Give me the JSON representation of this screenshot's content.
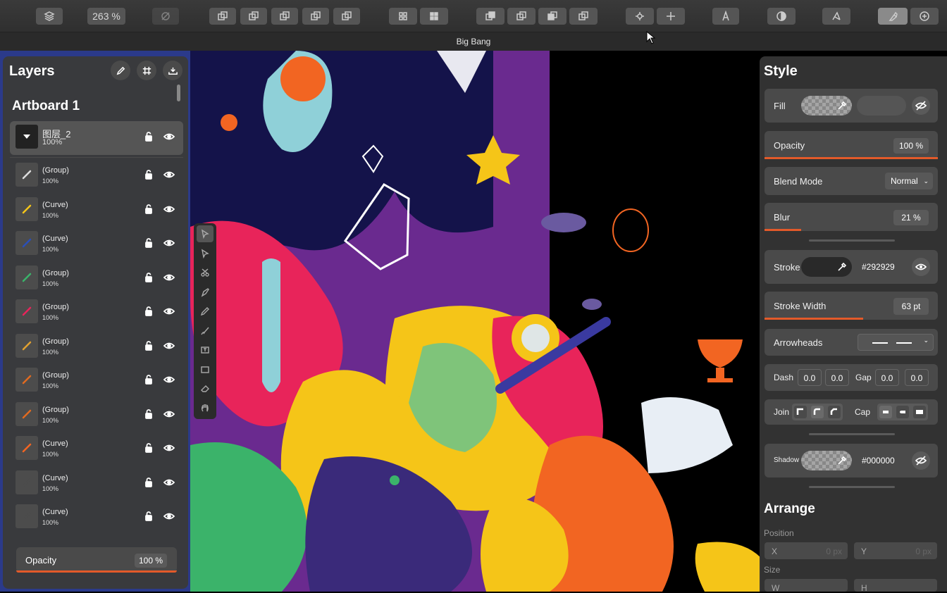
{
  "toolbar": {
    "zoom": "263 %"
  },
  "title": "Big Bang",
  "layers": {
    "title": "Layers",
    "artboard": "Artboard 1",
    "selected": {
      "name": "图层_2",
      "opacity": "100%"
    },
    "rows": [
      {
        "name": "(Group)",
        "opacity": "100%",
        "color": "#dddddd"
      },
      {
        "name": "(Curve)",
        "opacity": "100%",
        "color": "#f5c518"
      },
      {
        "name": "(Curve)",
        "opacity": "100%",
        "color": "#2a4fb8"
      },
      {
        "name": "(Group)",
        "opacity": "100%",
        "color": "#3bb36a"
      },
      {
        "name": "(Group)",
        "opacity": "100%",
        "color": "#e8245a"
      },
      {
        "name": "(Group)",
        "opacity": "100%",
        "color": "#e0a030"
      },
      {
        "name": "(Group)",
        "opacity": "100%",
        "color": "#e06a20"
      },
      {
        "name": "(Group)",
        "opacity": "100%",
        "color": "#e06a20"
      },
      {
        "name": "(Curve)",
        "opacity": "100%",
        "color": "#f26522"
      },
      {
        "name": "(Curve)",
        "opacity": "100%",
        "color": "#4c4c4c"
      },
      {
        "name": "(Curve)",
        "opacity": "100%",
        "color": "#4c4c4c"
      }
    ],
    "opacity_label": "Opacity",
    "opacity_value": "100 %",
    "opacity_level": 1.0
  },
  "style": {
    "title": "Style",
    "fill_label": "Fill",
    "opacity_label": "Opacity",
    "opacity_value": "100 %",
    "opacity_level": 1.0,
    "blend_label": "Blend Mode",
    "blend_value": "Normal",
    "blur_label": "Blur",
    "blur_value": "21 %",
    "blur_level": 0.21,
    "stroke_label": "Stroke",
    "stroke_hex": "#292929",
    "stroke_width_label": "Stroke Width",
    "stroke_width_value": "63 pt",
    "arrowheads_label": "Arrowheads",
    "dash_label": "Dash",
    "dash_values": [
      "0.0",
      "0.0"
    ],
    "gap_label": "Gap",
    "gap_values": [
      "0.0",
      "0.0"
    ],
    "join_label": "Join",
    "cap_label": "Cap",
    "shadow_label": "Shadow",
    "shadow_hex": "#000000",
    "arrange_title": "Arrange",
    "position_label": "Position",
    "x_label": "X",
    "x_value": "0 px",
    "y_label": "Y",
    "y_value": "0 px",
    "size_label": "Size",
    "w_label": "W",
    "h_label": "H"
  },
  "colors": {
    "accent": "#e35a2a",
    "panel": "#3a3a3a",
    "stroke": "#292929"
  }
}
